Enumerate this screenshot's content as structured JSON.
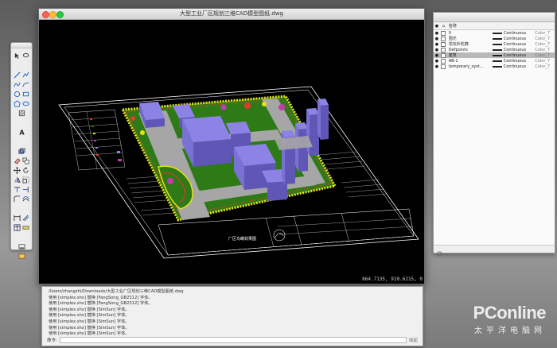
{
  "window": {
    "title": "大型工业厂区规划三维CAD模型图纸.dwg",
    "coordinates": "864.7135, 910.6215, 0"
  },
  "drawing": {
    "title_block_text": "厂区鸟瞰效果图",
    "colors": {
      "building": "#8d83e6",
      "building_side": "#5f56b5",
      "road": "#a6a6a6",
      "lawn": "#2d7a17",
      "flowers": "#e8e01a",
      "red_accent": "#e43a2d",
      "magenta_accent": "#c33bb0",
      "sheet_border": "#ffffff"
    }
  },
  "layers": {
    "headers": {
      "name": "名称",
      "linetype": "",
      "color": ""
    },
    "rows": [
      {
        "name": "0",
        "linetype": "Continuous",
        "color": "Color_7",
        "swatch": "#222222",
        "selected": false
      },
      {
        "name": "围光",
        "linetype": "Continuous",
        "color": "Color_7",
        "swatch": "#222222",
        "selected": false
      },
      {
        "name": "花坛外轮廓",
        "linetype": "Continuous",
        "color": "Color_7",
        "swatch": "#222222",
        "selected": false
      },
      {
        "name": "Defpoints",
        "linetype": "Continuous",
        "color": "Color_7",
        "swatch": "#222222",
        "selected": false
      },
      {
        "name": "建筑",
        "linetype": "Continuous",
        "color": "Color_7",
        "swatch": "#222222",
        "selected": true
      },
      {
        "name": "AB-1",
        "linetype": "Continuous",
        "color": "Color_7",
        "swatch": "#222222",
        "selected": false
      },
      {
        "name": "temporary_syst...",
        "linetype": "Continuous",
        "color": "Color_7",
        "swatch": "#222222",
        "selected": false
      }
    ]
  },
  "command": {
    "log": [
      "/Users/zhangzhi/Downloads/大型工业厂区规划三维CAD模型图纸.dwg",
      "使用 [simplex.shx] 替换 [FangSong_GB2312] 字体。",
      "使用 [simplex.shx] 替换 [FangSong_GB2312] 字体。",
      "使用 [simplex.shx] 替换 [SimSun] 字体。",
      "使用 [simplex.shx] 替换 [SimSun] 字体。",
      "使用 [simplex.shx] 替换 [SimSun] 字体。",
      "使用 [simplex.shx] 替换 [SimSun] 字体。",
      "使用 [simplex.shx] 替换 [SimSun] 字体。"
    ],
    "prompt_label": "命令:",
    "close_label": "收起"
  },
  "watermark": {
    "logo": "PConline",
    "subtitle": "太平洋电脑网"
  }
}
